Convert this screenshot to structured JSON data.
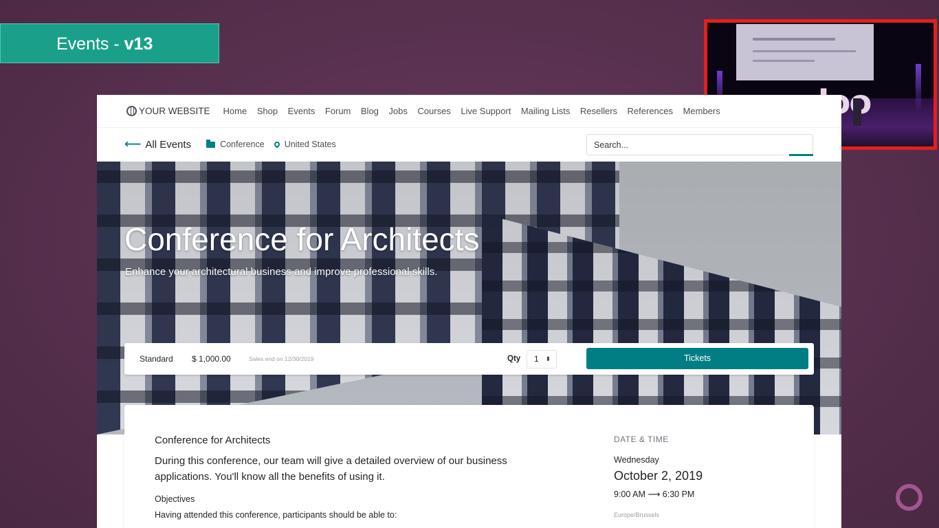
{
  "slide": {
    "title_prefix": "Events - ",
    "title_version": "v13"
  },
  "colors": {
    "accent": "#017e84",
    "banner": "#1aa08a",
    "slide_bg": "#57304e",
    "camera_border": "#e3201b"
  },
  "camera": {
    "logo_text": "odoo"
  },
  "site": {
    "brand": "YOUR WEBSITE",
    "menu": [
      "Home",
      "Shop",
      "Events",
      "Forum",
      "Blog",
      "Jobs",
      "Courses",
      "Live Support",
      "Mailing Lists",
      "Resellers",
      "References",
      "Members"
    ],
    "subnav": {
      "back_label": "All Events",
      "category": "Conference",
      "location": "United States",
      "search_placeholder": "Search..."
    },
    "hero": {
      "title": "Conference for Architects",
      "subtitle": "Enhance your architectural business and improve professional skills."
    },
    "ticket": {
      "name": "Standard",
      "price": "$ 1,000.00",
      "sales_end": "Sales end on 12/30/2019",
      "qty_label": "Qty",
      "qty_value": "1",
      "button_label": "Tickets"
    },
    "details": {
      "title": "Conference for Architects",
      "description": "During this conference, our team will give a detailed overview of our business applications. You'll know all the benefits of using it.",
      "objectives_heading": "Objectives",
      "objectives_intro": "Having attended this conference, participants should be able to:"
    },
    "datetime": {
      "label": "DATE & TIME",
      "weekday": "Wednesday",
      "date": "October 2, 2019",
      "start": "9:00 AM",
      "end": "6:30 PM",
      "timezone": "Europe/Brussels"
    }
  }
}
